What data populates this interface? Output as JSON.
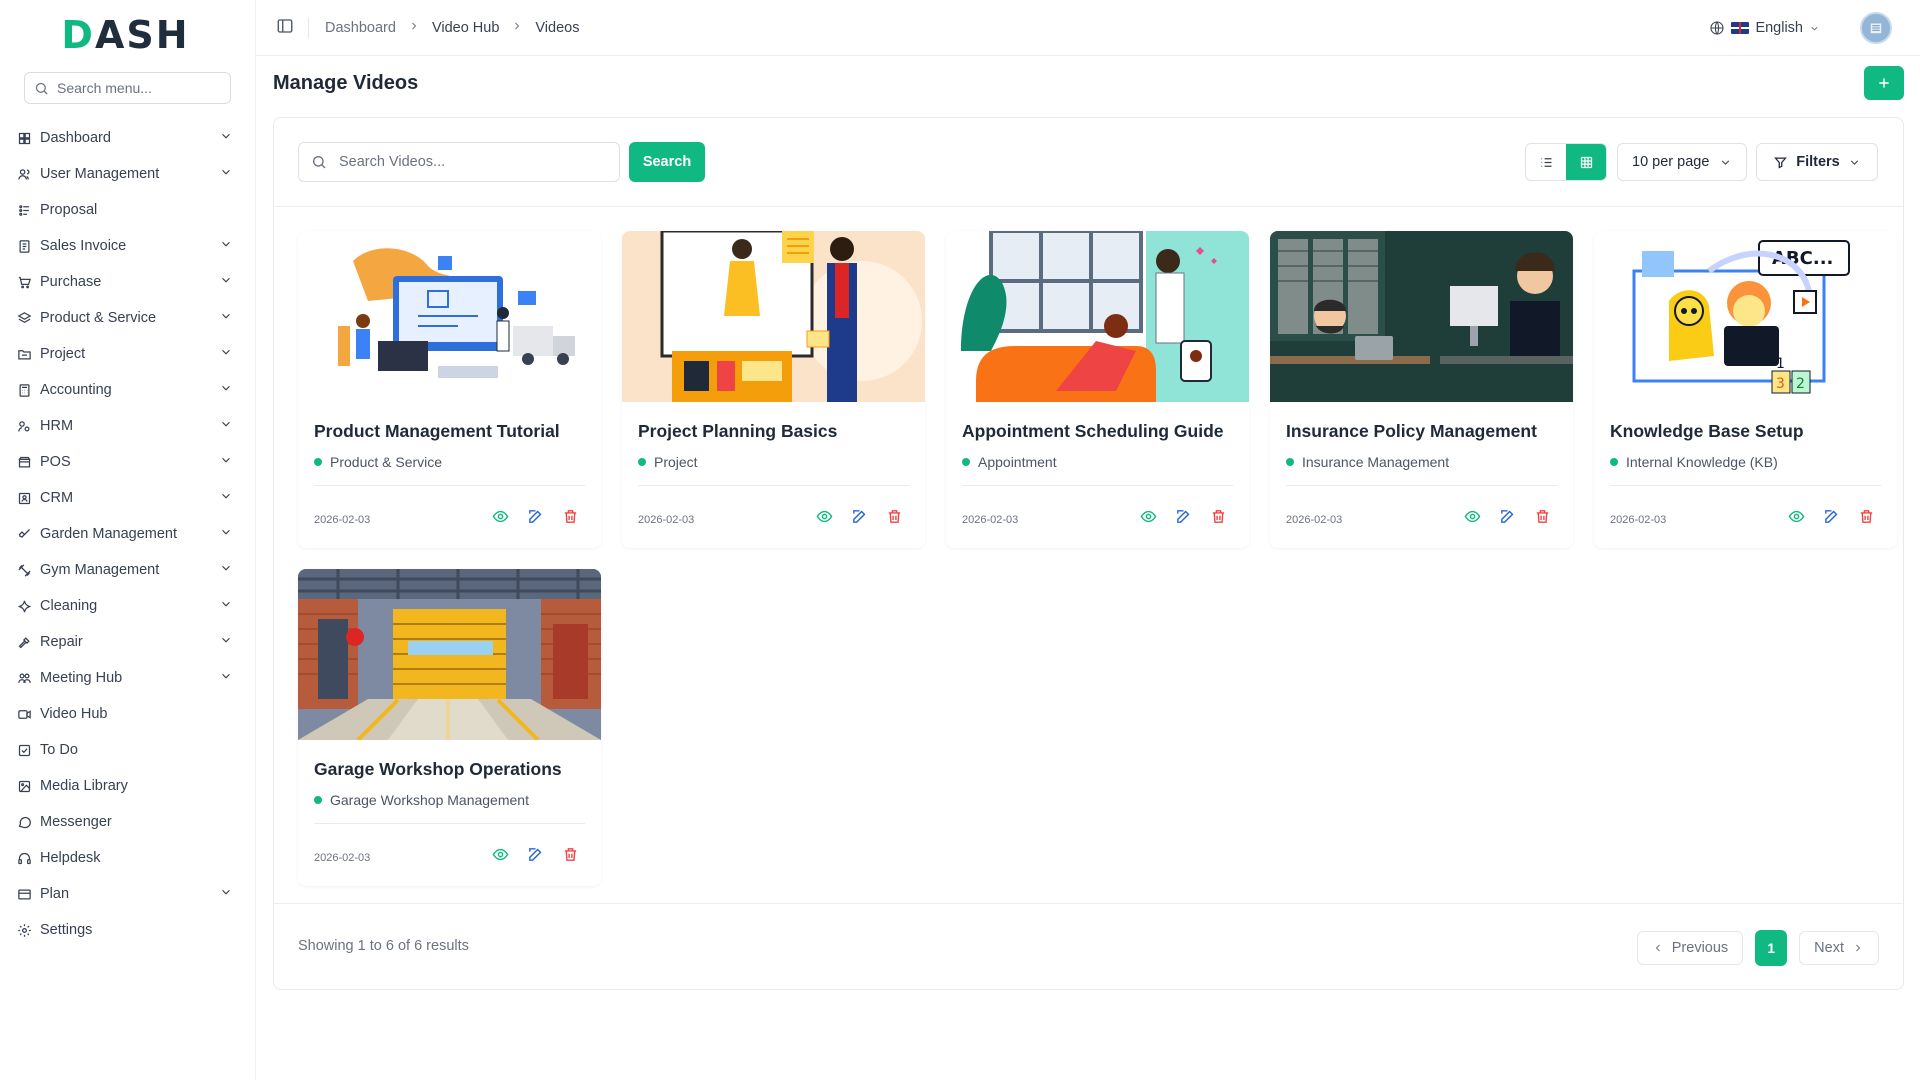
{
  "brand": {
    "logo_rest": "ASH",
    "logo_d": "D"
  },
  "sidebar": {
    "search_placeholder": "Search menu...",
    "items": [
      {
        "label": "Dashboard",
        "icon": "grid-icon",
        "has_children": true
      },
      {
        "label": "User Management",
        "icon": "users-icon",
        "has_children": true
      },
      {
        "label": "Proposal",
        "icon": "proposal-icon",
        "has_children": false
      },
      {
        "label": "Sales Invoice",
        "icon": "invoice-icon",
        "has_children": true
      },
      {
        "label": "Purchase",
        "icon": "cart-icon",
        "has_children": true
      },
      {
        "label": "Product & Service",
        "icon": "layers-icon",
        "has_children": true
      },
      {
        "label": "Project",
        "icon": "folder-icon",
        "has_children": true
      },
      {
        "label": "Accounting",
        "icon": "calculator-icon",
        "has_children": true
      },
      {
        "label": "HRM",
        "icon": "hrm-icon",
        "has_children": true
      },
      {
        "label": "POS",
        "icon": "pos-icon",
        "has_children": true
      },
      {
        "label": "CRM",
        "icon": "crm-icon",
        "has_children": true
      },
      {
        "label": "Garden Management",
        "icon": "shovel-icon",
        "has_children": true
      },
      {
        "label": "Gym Management",
        "icon": "dumbbell-icon",
        "has_children": true
      },
      {
        "label": "Cleaning",
        "icon": "sparkle-icon",
        "has_children": true
      },
      {
        "label": "Repair",
        "icon": "hammer-icon",
        "has_children": true
      },
      {
        "label": "Meeting Hub",
        "icon": "meeting-icon",
        "has_children": true
      },
      {
        "label": "Video Hub",
        "icon": "video-icon",
        "has_children": false
      },
      {
        "label": "To Do",
        "icon": "checkbox-icon",
        "has_children": false
      },
      {
        "label": "Media Library",
        "icon": "image-icon",
        "has_children": false
      },
      {
        "label": "Messenger",
        "icon": "chat-icon",
        "has_children": false
      },
      {
        "label": "Helpdesk",
        "icon": "headset-icon",
        "has_children": false
      },
      {
        "label": "Plan",
        "icon": "plan-icon",
        "has_children": true
      },
      {
        "label": "Settings",
        "icon": "gear-icon",
        "has_children": false
      }
    ]
  },
  "topbar": {
    "breadcrumb": [
      "Dashboard",
      "Video Hub",
      "Videos"
    ],
    "language": "English"
  },
  "page": {
    "title": "Manage Videos"
  },
  "toolbar": {
    "search_placeholder": "Search Videos...",
    "search_button": "Search",
    "per_page": "10 per page",
    "filters": "Filters"
  },
  "videos": [
    {
      "title": "Product Management Tutorial",
      "category": "Product & Service",
      "date": "2026-02-03",
      "thumb": "product"
    },
    {
      "title": "Project Planning Basics",
      "category": "Project",
      "date": "2026-02-03",
      "thumb": "project"
    },
    {
      "title": "Appointment Scheduling Guide",
      "category": "Appointment",
      "date": "2026-02-03",
      "thumb": "appointment"
    },
    {
      "title": "Insurance Policy Management",
      "category": "Insurance Management",
      "date": "2026-02-03",
      "thumb": "insurance"
    },
    {
      "title": "Knowledge Base Setup",
      "category": "Internal Knowledge (KB)",
      "date": "2026-02-03",
      "thumb": "knowledge"
    },
    {
      "title": "Garage Workshop Operations",
      "category": "Garage Workshop Management",
      "date": "2026-02-03",
      "thumb": "garage"
    }
  ],
  "footer": {
    "showing": "Showing 1 to 6 of 6 results",
    "previous": "Previous",
    "next": "Next",
    "current_page": "1"
  },
  "colors": {
    "accent": "#10b981",
    "edit": "#2563eb",
    "delete": "#ef4444"
  }
}
